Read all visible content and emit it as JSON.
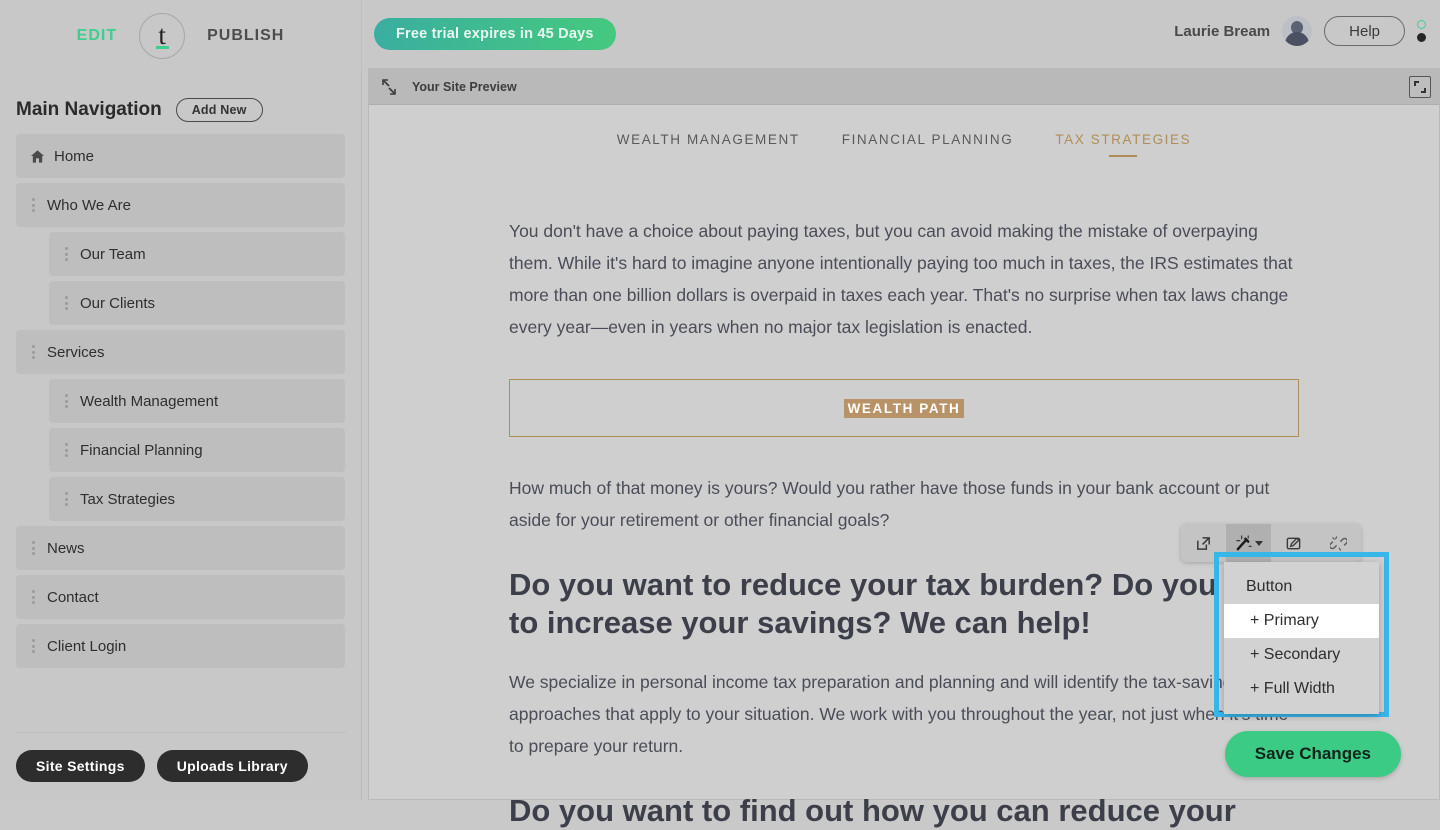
{
  "brand": {
    "edit_label": "EDIT",
    "publish_label": "PUBLISH",
    "logo_letter": "t",
    "accent_green": "#3ecf8e"
  },
  "sidebar": {
    "nav_title": "Main Navigation",
    "add_new_label": "Add New",
    "items": [
      {
        "label": "Home",
        "icon": "home-icon",
        "child": false
      },
      {
        "label": "Who We Are",
        "icon": "drag-handle-icon",
        "child": false
      },
      {
        "label": "Our Team",
        "icon": "drag-handle-icon",
        "child": true
      },
      {
        "label": "Our Clients",
        "icon": "drag-handle-icon",
        "child": true
      },
      {
        "label": "Services",
        "icon": "drag-handle-icon",
        "child": false
      },
      {
        "label": "Wealth Management",
        "icon": "drag-handle-icon",
        "child": true
      },
      {
        "label": "Financial Planning",
        "icon": "drag-handle-icon",
        "child": true
      },
      {
        "label": "Tax Strategies",
        "icon": "drag-handle-icon",
        "child": true
      },
      {
        "label": "News",
        "icon": "drag-handle-icon",
        "child": false
      },
      {
        "label": "Contact",
        "icon": "drag-handle-icon",
        "child": false
      },
      {
        "label": "Client Login",
        "icon": "drag-handle-icon",
        "child": false
      }
    ],
    "footer": {
      "site_settings_label": "Site Settings",
      "uploads_library_label": "Uploads Library"
    }
  },
  "topbar": {
    "trial_badge": "Free trial expires in 45 Days",
    "trial_gradient_from": "#3aaea0",
    "trial_gradient_to": "#45c97e",
    "user_name": "Laurie Bream",
    "help_label": "Help",
    "avatar_icon": "user-avatar",
    "status_ring_color": "#3ecf8e",
    "status_dot_color": "#262626"
  },
  "preview": {
    "bar_label": "Your Site Preview",
    "collapse_icon": "collapse-arrows-icon",
    "expand_icon": "expand-fullscreen-icon",
    "site_nav": [
      {
        "label": "WEALTH MANAGEMENT",
        "active": false
      },
      {
        "label": "FINANCIAL PLANNING",
        "active": false
      },
      {
        "label": "TAX STRATEGIES",
        "active": true
      }
    ],
    "accent_gold": "#b08d57",
    "content": {
      "para1": "You don't have a choice about paying taxes, but you can avoid making the mistake of overpaying them. While it's hard to imagine anyone intentionally paying too much in taxes, the IRS estimates that more than one billion dollars is overpaid in taxes each year. That's no surprise when tax laws change every year—even in years when no major tax legislation is enacted.",
      "wealth_path_label": "WEALTH PATH",
      "para2": "How much of that money is yours? Would you rather have those funds in your bank account or put aside for your retirement or other financial goals?",
      "heading1": "Do you want to reduce your tax burden? Do you want to increase your savings? We can help!",
      "para3": "We specialize in personal income tax preparation and planning and will identify the tax-saving approaches that apply to your situation. We work with you throughout the year, not just when it's time to prepare your return.",
      "heading2": "Do you want to find out how you can reduce your"
    }
  },
  "float_toolbar": {
    "buttons": [
      {
        "icon": "external-link-icon",
        "active": false,
        "caret": false
      },
      {
        "icon": "magic-wand-icon",
        "active": true,
        "caret": true
      },
      {
        "icon": "edit-box-icon",
        "active": false,
        "caret": false
      },
      {
        "icon": "unlink-icon",
        "active": false,
        "caret": false
      }
    ]
  },
  "dropdown": {
    "highlight_color": "#37b6e8",
    "header_label": "Button",
    "items": [
      {
        "label": "+ Primary",
        "hovered": true
      },
      {
        "label": "+ Secondary",
        "hovered": false
      },
      {
        "label": "+ Full Width",
        "hovered": false
      }
    ]
  },
  "save": {
    "label": "Save Changes",
    "color": "#3ccb84"
  }
}
